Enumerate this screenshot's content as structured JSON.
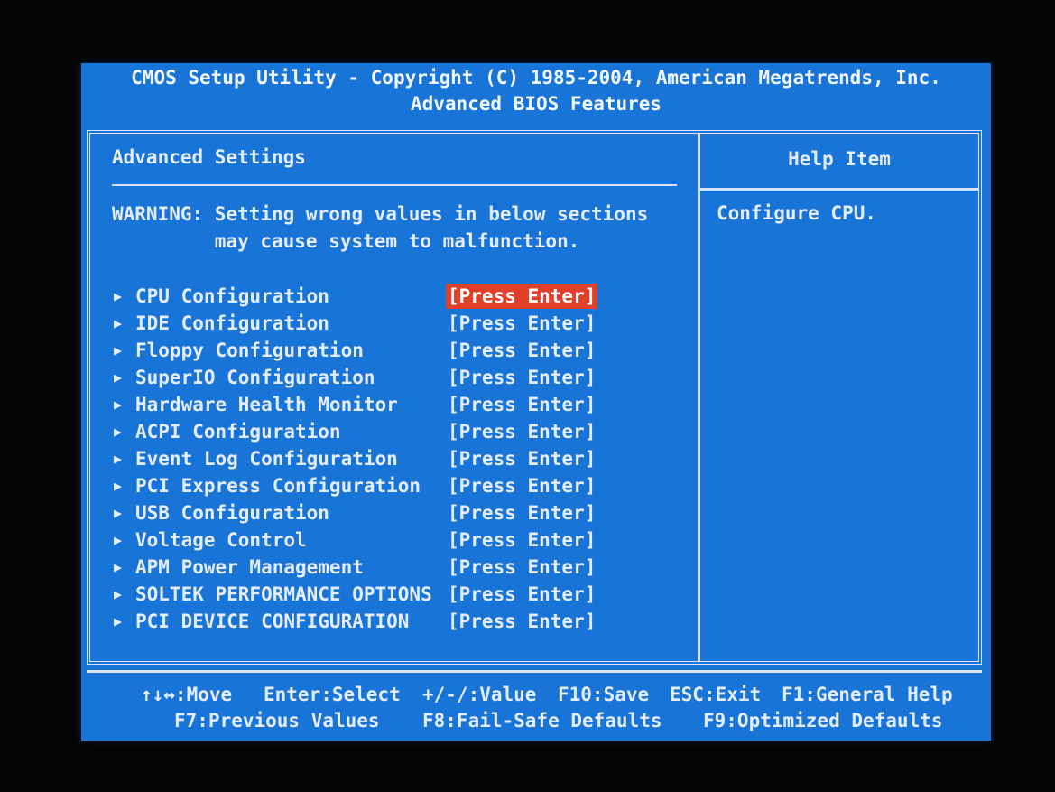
{
  "header": {
    "title": "CMOS Setup Utility - Copyright (C) 1985-2004, American Megatrends, Inc.",
    "subtitle": "Advanced BIOS Features"
  },
  "left_pane": {
    "section_title": "Advanced Settings",
    "warning_line1": "WARNING: Setting wrong values in below sections",
    "warning_line2": "         may cause system to malfunction.",
    "arrow_glyph": "▶",
    "items": [
      {
        "label": "CPU Configuration",
        "value": "[Press Enter]",
        "selected": true
      },
      {
        "label": "IDE Configuration",
        "value": "[Press Enter]",
        "selected": false
      },
      {
        "label": "Floppy Configuration",
        "value": "[Press Enter]",
        "selected": false
      },
      {
        "label": "SuperIO Configuration",
        "value": "[Press Enter]",
        "selected": false
      },
      {
        "label": "Hardware Health Monitor",
        "value": "[Press Enter]",
        "selected": false
      },
      {
        "label": "ACPI Configuration",
        "value": "[Press Enter]",
        "selected": false
      },
      {
        "label": "Event Log Configuration",
        "value": "[Press Enter]",
        "selected": false
      },
      {
        "label": "PCI Express Configuration",
        "value": "[Press Enter]",
        "selected": false
      },
      {
        "label": "USB Configuration",
        "value": "[Press Enter]",
        "selected": false
      },
      {
        "label": "Voltage Control",
        "value": "[Press Enter]",
        "selected": false
      },
      {
        "label": "APM Power Management",
        "value": "[Press Enter]",
        "selected": false
      },
      {
        "label": "SOLTEK PERFORMANCE OPTIONS",
        "value": "[Press Enter]",
        "selected": false
      },
      {
        "label": "PCI DEVICE CONFIGURATION",
        "value": "[Press Enter]",
        "selected": false
      }
    ]
  },
  "help": {
    "title": "Help Item",
    "text": "Configure CPU."
  },
  "footer": {
    "move": "↑↓↔:Move",
    "select": "Enter:Select",
    "value": "+/-/:Value",
    "save": "F10:Save",
    "exit": "ESC:Exit",
    "general_help": "F1:General Help",
    "previous": "F7:Previous Values",
    "failsafe": "F8:Fail-Safe Defaults",
    "optimized": "F9:Optimized Defaults"
  },
  "colors": {
    "screen_background": "#1874d6",
    "text": "#e4ecff",
    "highlight": "#e0402a"
  }
}
